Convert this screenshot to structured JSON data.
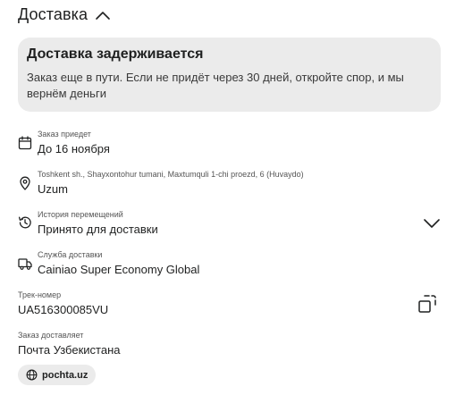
{
  "section": {
    "title": "Доставка",
    "toggle_icon": "chevron-up-icon"
  },
  "alert": {
    "title": "Доставка задерживается",
    "text": "Заказ еще в пути. Если не придёт через 30 дней, откройте спор, и мы вернём деньги"
  },
  "details": {
    "arrival": {
      "label": "Заказ приедет",
      "value": "До 16 ноября",
      "icon": "calendar-icon"
    },
    "address": {
      "label": "Toshkent sh., Shayxontohur tumani, Maxtumquli 1-chi proezd, 6 (Huvaydo)",
      "value": "Uzum",
      "icon": "location-pin-icon"
    },
    "history": {
      "label": "История перемещений",
      "value": "Принято для доставки",
      "icon": "clock-history-icon",
      "expand_icon": "chevron-down-icon"
    },
    "service": {
      "label": "Служба доставки",
      "value": "Cainiao Super Economy Global",
      "icon": "truck-icon"
    },
    "tracking": {
      "label": "Трек-номер",
      "value": "UA516300085VU",
      "copy_icon": "copy-icon"
    },
    "carrier": {
      "label": "Заказ доставляет",
      "value": "Почта Узбекистана"
    }
  },
  "link": {
    "text": "pochta.uz",
    "icon": "globe-icon"
  }
}
